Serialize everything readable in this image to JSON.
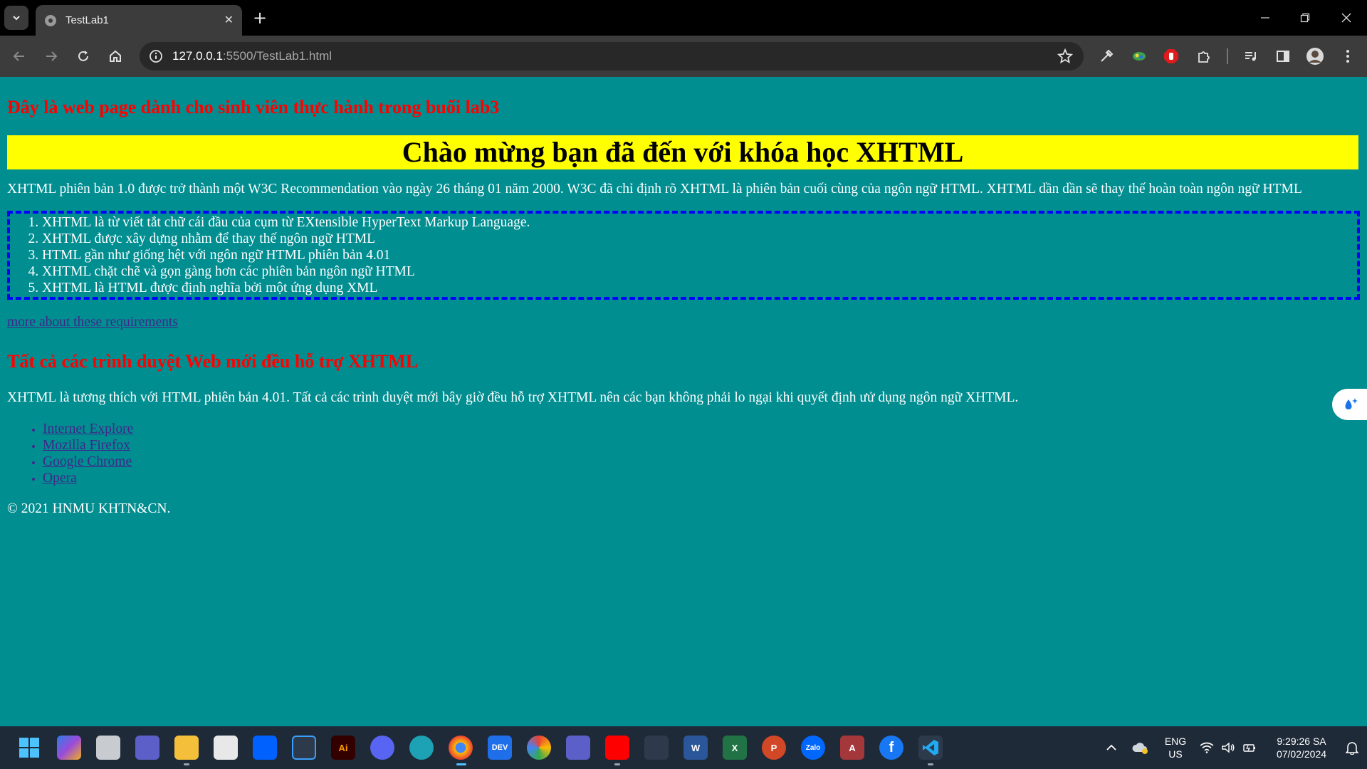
{
  "browser": {
    "tab_title": "TestLab1",
    "tab_close": "✕",
    "new_tab": "+",
    "url_host": "127.0.0.1",
    "url_rest": ":5500/TestLab1.html"
  },
  "page": {
    "intro_heading": "Đây là web page dành cho sinh viên thực hành trong buổi lab3",
    "welcome_banner": "Chào mừng bạn đã đến với khóa học XHTML",
    "paragraph1": "XHTML phiên bản 1.0 được trở thành một W3C Recommendation vào ngày 26 tháng 01 năm 2000. W3C đã chỉ định rõ XHTML là phiên bản cuối cùng của ngôn ngữ HTML. XHTML dần dần sẽ thay thế hoàn toàn ngôn ngữ HTML",
    "features": [
      "XHTML là từ viết tắt chữ cái đầu của cụm từ EXtensible HyperText Markup Language.",
      "XHTML được xây dựng nhằm để thay thế ngôn ngữ HTML",
      "HTML gần như giống hệt với ngôn ngữ HTML phiên bản 4.01",
      "XHTML chặt chẽ và gọn gàng hơn các phiên bản ngôn ngữ HTML",
      "XHTML là HTML được định nghĩa bởi một ứng dụng XML"
    ],
    "more_link": "more about these requirements",
    "sub_heading": "Tất cả các trình duyệt Web mới đều hỗ trợ XHTML",
    "paragraph2": "XHTML là tương thích với HTML phiên bản 4.01. Tất cả các trình duyệt mới bây giờ đều hỗ trợ XHTML nên các bạn không phải lo ngại khi quyết định ưử dụng ngôn ngữ XHTML.",
    "browsers": [
      "Internet Explore",
      "Mozilla Firefox",
      "Google Chrome",
      "Opera"
    ],
    "footer": "© 2021 HNMU KHTN&CN."
  },
  "taskbar": {
    "lang_line1": "ENG",
    "lang_line2": "US",
    "time": "9:29:26 SA",
    "date": "07/02/2024"
  },
  "colors": {
    "page_bg": "#008e91",
    "heading_red": "#ff0000",
    "banner_yellow": "#ffff00",
    "dashed_border": "#0000ff",
    "link": "#40278a"
  }
}
